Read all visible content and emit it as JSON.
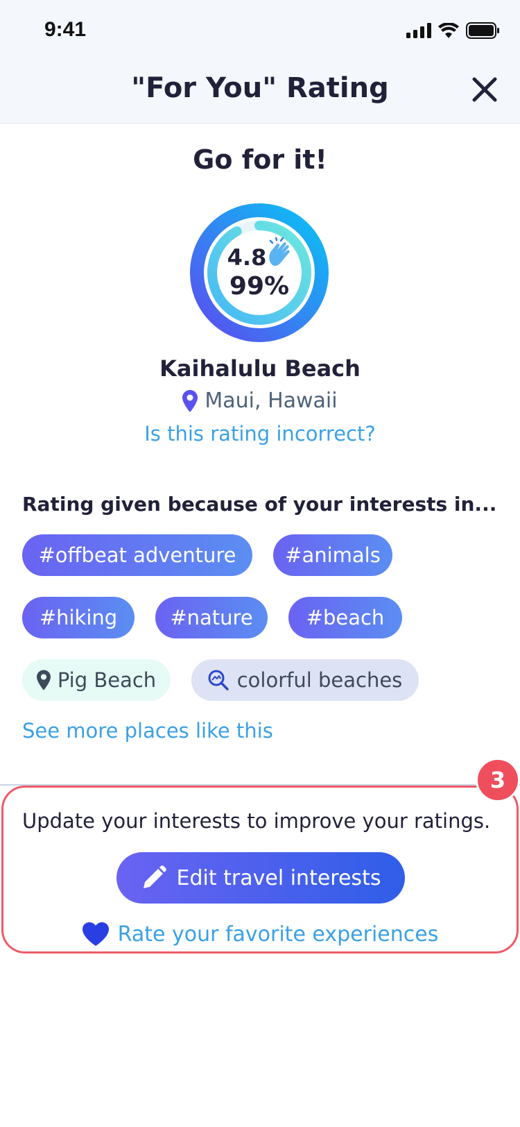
{
  "status_bar": {
    "time": "9:41",
    "icons": [
      "signal-icon",
      "wifi-icon",
      "battery-icon"
    ]
  },
  "header": {
    "title": "\"For You\" Rating",
    "close_icon": "close-icon"
  },
  "verdict": "Go for it!",
  "rating": {
    "score": "4.8",
    "percent": "99%",
    "percent_value": 0.99,
    "icon": "clapping-hands-icon"
  },
  "place": {
    "name": "Kaihalulu Beach",
    "location": "Maui, Hawaii",
    "location_icon": "location-pin-icon"
  },
  "incorrect_link": "Is this rating incorrect?",
  "interests": {
    "title": "Rating given because of your interests in...",
    "tags": [
      "#offbeat adventure",
      "#animals",
      "#hiking",
      "#nature",
      "#beach"
    ],
    "similar_place": "Pig Beach",
    "search_term": "colorful beaches"
  },
  "see_more": "See more places like this",
  "cta": {
    "badge": "3",
    "text": "Update your interests to improve your ratings.",
    "edit_button": "Edit travel interests",
    "rate_link": "Rate your favorite experiences"
  },
  "colors": {
    "accent": "#6a63f2",
    "link": "#3aa0e6",
    "highlight": "#ef4f5c"
  }
}
